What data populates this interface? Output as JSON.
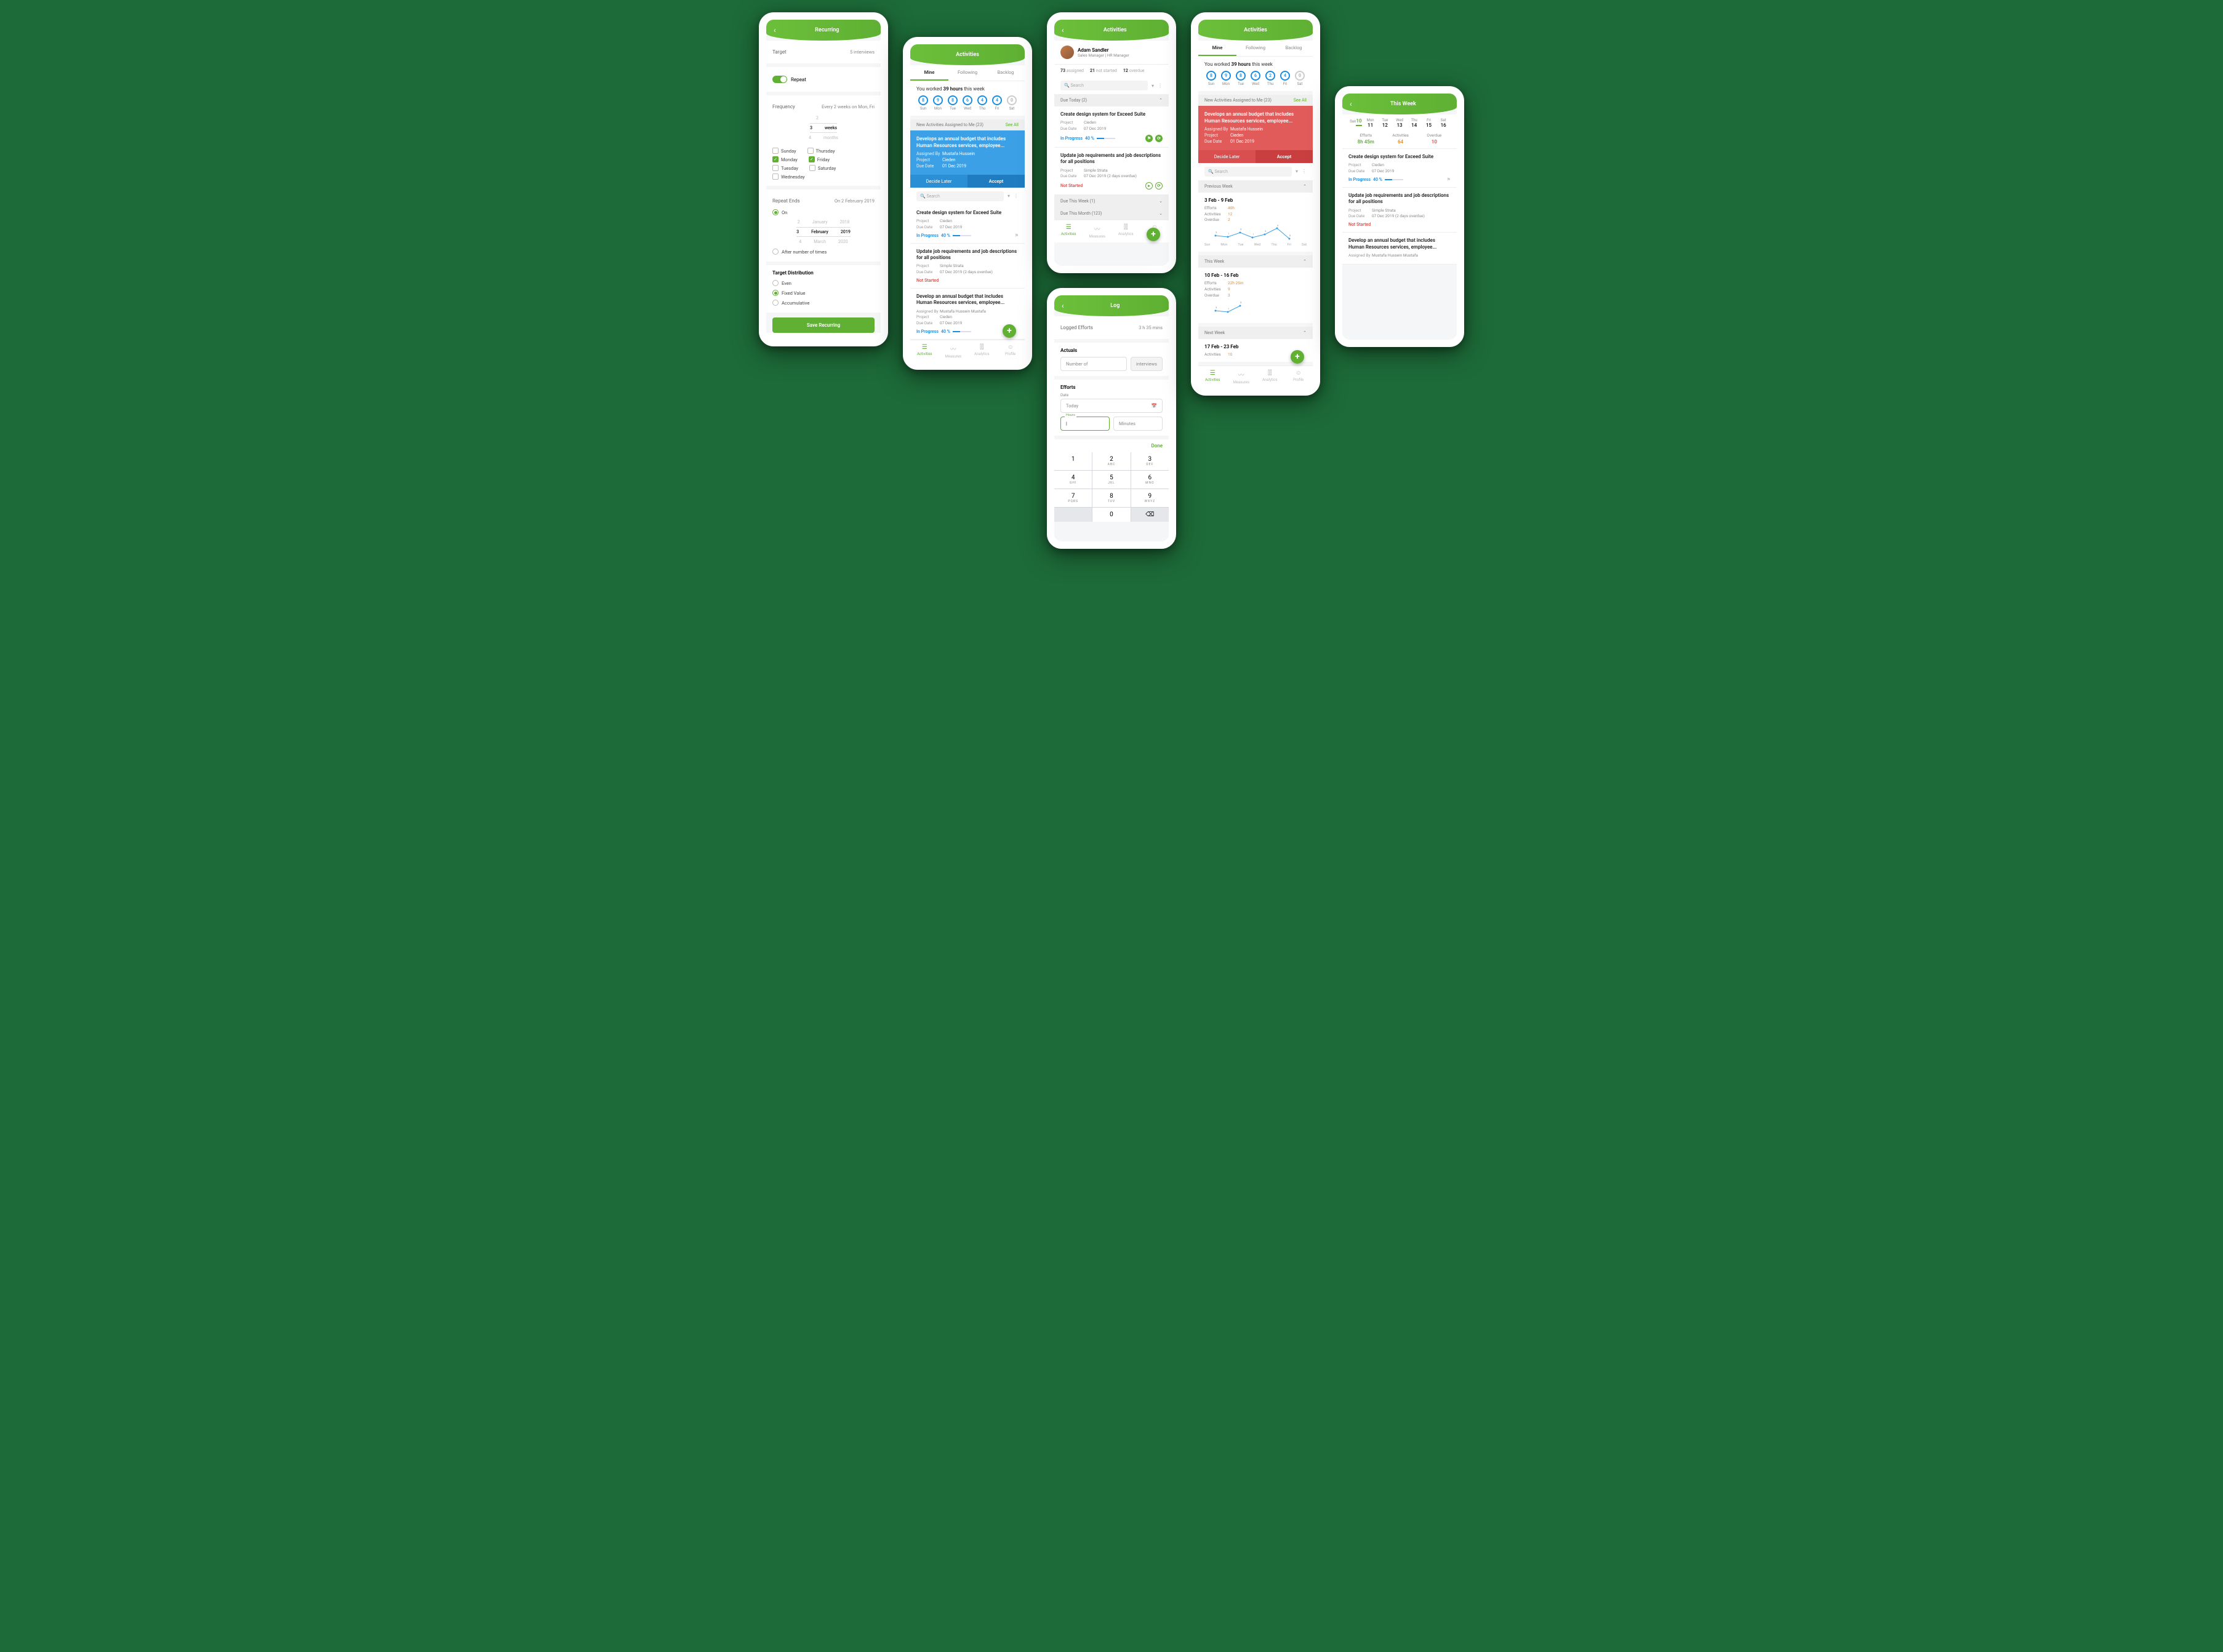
{
  "screen1": {
    "title": "Recurring",
    "target_label": "Target",
    "target_value": "5 interviews",
    "repeat_label": "Repeat",
    "frequency_label": "Frequency",
    "frequency_value": "Every 2 weeks on Mon, Fri",
    "picker_prev_num": "2",
    "picker_num": "3",
    "picker_unit": "weeks",
    "picker_next_num": "4",
    "picker_next_unit": "months",
    "days": {
      "sunday": "Sunday",
      "monday": "Monday",
      "tuesday": "Tuesday",
      "wednesday": "Wednesday",
      "thursday": "Thursday",
      "friday": "Friday",
      "saturday": "Saturday"
    },
    "repeat_ends_label": "Repeat Ends",
    "repeat_ends_value": "On 2 February 2019",
    "on_label": "On",
    "end_picker_prev": {
      "d": "2",
      "m": "January",
      "y": "2018"
    },
    "end_picker": {
      "d": "3",
      "m": "February",
      "y": "2019"
    },
    "end_picker_next": {
      "d": "4",
      "m": "March",
      "y": "2020"
    },
    "after_label": "After number of times",
    "target_dist_label": "Target Distribution",
    "dist": {
      "even": "Even",
      "fixed": "Fixed Value",
      "acc": "Accumulative"
    },
    "save": "Save Recurring"
  },
  "screen2": {
    "title": "Activities",
    "tabs": {
      "mine": "Mine",
      "following": "Following",
      "backlog": "Backlog"
    },
    "worked_a": "You worked ",
    "worked_b": "39 hours",
    "worked_c": " this week",
    "days": [
      {
        "val": "8",
        "lbl": "Sun"
      },
      {
        "val": "9",
        "lbl": "Mon"
      },
      {
        "val": "8",
        "lbl": "Tue"
      },
      {
        "val": "6",
        "lbl": "Wed"
      },
      {
        "val": "4",
        "lbl": "Thu"
      },
      {
        "val": "4",
        "lbl": "Fri"
      },
      {
        "val": "0",
        "lbl": "Sat",
        "gray": true
      }
    ],
    "assigned_header": "New Activities Assigned to Me (23)",
    "see_all": "See All",
    "notif": {
      "title": "Develops an annual budget that includes Human Resources services, employee...",
      "assigned_by_lbl": "Assigned By",
      "assigned_by": "Mustafa Hussein",
      "project_lbl": "Project",
      "project": "Cieden",
      "due_lbl": "Due Date",
      "due": "01 Dec 2019",
      "decide": "Decide Later",
      "accept": "Accept"
    },
    "search": "Search",
    "card1": {
      "title": "Create design system for Exceed Suite",
      "project_lbl": "Project",
      "project": "Cieden",
      "due_lbl": "Due Date",
      "due": "07 Dec 2019",
      "status": "In Progress",
      "pct": "40 %"
    },
    "card2": {
      "title": "Update job requirements and job descriptions for all positions",
      "project_lbl": "Project",
      "project": "Simple Strata",
      "due_lbl": "Due Date",
      "due": "07 Dec 2019  (2 days overdue)",
      "status": "Not Started"
    },
    "card3": {
      "title": "Develop an annual budget that includes Human Resources services, employee...",
      "assigned_by_lbl": "Assigned By",
      "assigned_by": "Mustafa Hussein Mustafa",
      "project_lbl": "Project",
      "project": "Cieden",
      "due_lbl": "Due Date",
      "due": "07 Dec 2019",
      "status": "In Progress",
      "pct": "40 %"
    },
    "nav": {
      "activities": "Activities",
      "measures": "Measures",
      "analytics": "Analytics",
      "profile": "Profile"
    }
  },
  "screen3": {
    "title": "Activities",
    "name": "Adam Sandler",
    "role": "Sales Manager  |  HR Manager",
    "stats": {
      "assigned_n": "73",
      "assigned": "assigned",
      "notstarted_n": "21",
      "notstarted": "not started",
      "overdue_n": "12",
      "overdue": "overdue"
    },
    "search": "Search",
    "due_today": "Due Today (2)",
    "card1": {
      "title": "Create design system for Exceed Suite",
      "project_lbl": "Project",
      "project": "Cieden",
      "due_lbl": "Due Date",
      "due": "07 Dec 2019",
      "status": "In Progress",
      "pct": "40 %"
    },
    "card2": {
      "title": "Update job requirements and job descriptions for all positions",
      "project_lbl": "Project",
      "project": "Simple Strata",
      "due_lbl": "Due Date",
      "due": "07 Dec 2019  (2 days overdue)",
      "status": "Not Started"
    },
    "due_week": "Due This Week (1)",
    "due_month": "Due This Month (123)",
    "nav": {
      "activities": "Activities",
      "measures": "Measures",
      "analytics": "Analytics",
      "profile": "Profile"
    }
  },
  "screen4": {
    "title": "Log",
    "logged_lbl": "Logged Efforts",
    "logged_val": "3 h 35 mins",
    "actuals": "Actuals",
    "number_of": "Number of",
    "interviews": "interviews",
    "efforts": "Efforts",
    "date_lbl": "Date",
    "today": "Today",
    "hours": "Hours",
    "minutes": "Minutes",
    "done": "Done",
    "keys": [
      {
        "n": "1",
        "t": ""
      },
      {
        "n": "2",
        "t": "ABC"
      },
      {
        "n": "3",
        "t": "DEF"
      },
      {
        "n": "4",
        "t": "GHI"
      },
      {
        "n": "5",
        "t": "JKL"
      },
      {
        "n": "6",
        "t": "MNO"
      },
      {
        "n": "7",
        "t": "PQRS"
      },
      {
        "n": "8",
        "t": "TUV"
      },
      {
        "n": "9",
        "t": "WXYZ"
      },
      {
        "n": "",
        "gray": true
      },
      {
        "n": "0",
        "t": ""
      },
      {
        "n": "⌫",
        "gray": true
      }
    ]
  },
  "screen5": {
    "title": "Activities",
    "tabs": {
      "mine": "Mine",
      "following": "Following",
      "backlog": "Backlog"
    },
    "worked_a": "You worked ",
    "worked_b": "39 hours",
    "worked_c": " this week",
    "days": [
      {
        "val": "8",
        "lbl": "Sun"
      },
      {
        "val": "9",
        "lbl": "Mon"
      },
      {
        "val": "8",
        "lbl": "Tue"
      },
      {
        "val": "6",
        "lbl": "Wed"
      },
      {
        "val": "2",
        "lbl": "Thu"
      },
      {
        "val": "4",
        "lbl": "Fri"
      },
      {
        "val": "0",
        "lbl": "Sat",
        "gray": true
      }
    ],
    "assigned_header": "New Activities Assigned to Me (23)",
    "see_all": "See All",
    "notif": {
      "title": "Develops an annual budget that includes Human Resources services, employee...",
      "assigned_by_lbl": "Assigned By",
      "assigned_by": "Mustafa Hussein",
      "project_lbl": "Project",
      "project": "Cieden",
      "due_lbl": "Due Date",
      "due": "01 Dec 2019",
      "decide": "Decide Later",
      "accept": "Accept"
    },
    "search": "Search",
    "prev_week": "Previous Week",
    "week1_range": "3 Feb - 9 Feb",
    "week1": {
      "efforts_lbl": "Efforts",
      "efforts": "40h",
      "act_lbl": "Activities",
      "act": "12",
      "over_lbl": "Overdue",
      "over": "2"
    },
    "axis": [
      "Sun",
      "Mon",
      "Tue",
      "Wed",
      "Thu",
      "Fri",
      "Sat"
    ],
    "this_week": "This Week",
    "week2_range": "10 Feb - 16 Feb",
    "week2": {
      "efforts_lbl": "Efforts",
      "efforts": "22h 25m",
      "act_lbl": "Activities",
      "act": "9",
      "over_lbl": "Overdue",
      "over": "3"
    },
    "next_week": "Next Week",
    "week3_range": "17 Feb - 23 Feb",
    "week3": {
      "act_lbl": "Activities",
      "act": "10"
    },
    "nav": {
      "activities": "Activities",
      "measures": "Measures",
      "analytics": "Analytics",
      "profile": "Profile"
    }
  },
  "screen6": {
    "title": "This Week",
    "days": [
      {
        "lbl": "Sun",
        "n": "10",
        "active": true
      },
      {
        "lbl": "Mon",
        "n": "11"
      },
      {
        "lbl": "Tue",
        "n": "12"
      },
      {
        "lbl": "Wed",
        "n": "13"
      },
      {
        "lbl": "Thu",
        "n": "14"
      },
      {
        "lbl": "Fri",
        "n": "15"
      },
      {
        "lbl": "Sat",
        "n": "16"
      }
    ],
    "summary": {
      "efforts_lbl": "Efforts",
      "efforts": "8h 45m",
      "act_lbl": "Activities",
      "act": "64",
      "over_lbl": "Overdue",
      "over": "10"
    },
    "card1": {
      "title": "Create design system for Exceed Suite",
      "project_lbl": "Project",
      "project": "Cieden",
      "due_lbl": "Due Date",
      "due": "07 Dec 2019",
      "status": "In Progress",
      "pct": "40 %"
    },
    "card2": {
      "title": "Update job requirements and job descriptions for all positions",
      "project_lbl": "Project",
      "project": "Simple Strata",
      "due_lbl": "Due Date",
      "due": "07 Dec 2019  (2 days overdue)",
      "status": "Not Started"
    },
    "card3": {
      "title": "Develop an annual budget that includes Human Resources services, employee...",
      "assigned_by_lbl": "Assigned By",
      "assigned_by": "Mustafa Hussein Mustafa"
    }
  }
}
